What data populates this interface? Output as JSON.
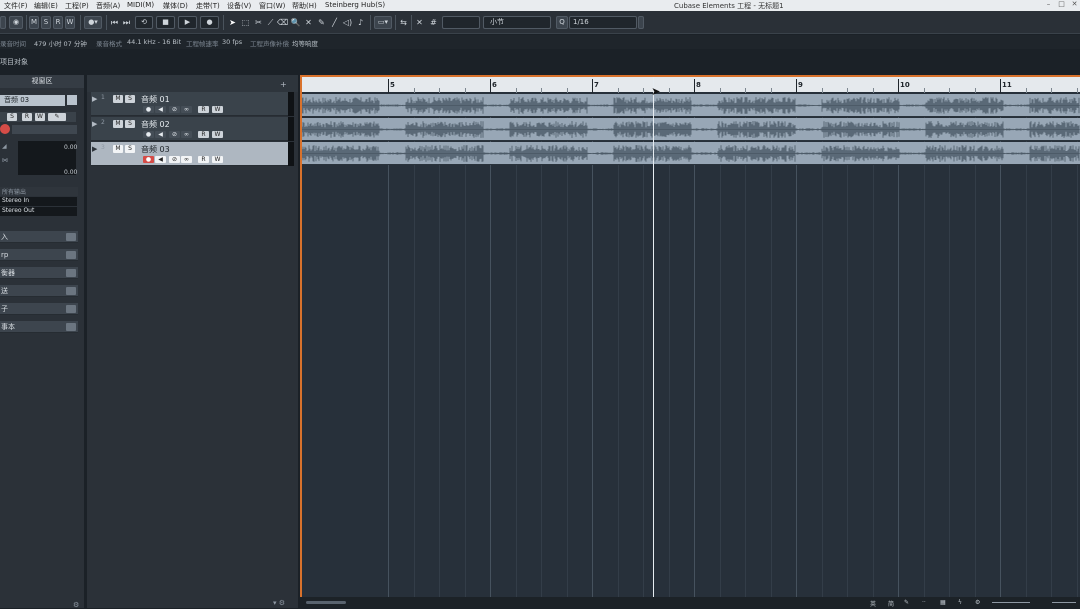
{
  "window": {
    "title": "Cubase Elements 工程 - 无标题1"
  },
  "menu": [
    {
      "label": "文件(F)"
    },
    {
      "label": "编辑(E)"
    },
    {
      "label": "工程(P)"
    },
    {
      "label": "音频(A)"
    },
    {
      "label": "MIDI(M)"
    },
    {
      "label": "媒体(D)"
    },
    {
      "label": "走带(T)"
    },
    {
      "label": "设备(V)"
    },
    {
      "label": "窗口(W)"
    },
    {
      "label": "帮助(H)"
    },
    {
      "label": "Steinberg Hub(S)"
    }
  ],
  "toolbar": {
    "m_label": "M",
    "s_label": "S",
    "r_label": "R",
    "w_label": "W",
    "snap_type": "小节",
    "quantize": "1/16"
  },
  "info_line": {
    "record_time_label": "录音时间",
    "record_time_value": "479 小时 07 分钟",
    "record_format_label": "录音格式",
    "record_format_value": "44.1 kHz - 16 Bit",
    "frame_rate_label": "工程帧速率",
    "frame_rate_value": "30 fps",
    "pan_law_label": "工程声像补偿",
    "pan_law_value": "均等响度"
  },
  "project_label": "项目对象",
  "inspector": {
    "title": "视窗区",
    "track_name": "音频 03",
    "volume_value": "0.00",
    "pan_value": "0.00",
    "routing_label": "所有输出",
    "input": "Stereo In",
    "output": "Stereo Out",
    "sections": [
      {
        "label": "入"
      },
      {
        "label": "rp"
      },
      {
        "label": "衡器"
      },
      {
        "label": "送"
      },
      {
        "label": "子"
      },
      {
        "label": "事本"
      }
    ]
  },
  "tracks": [
    {
      "number": "1",
      "name": "音频 01",
      "m": "M",
      "s": "S",
      "r": "R",
      "w": "W",
      "selected": false
    },
    {
      "number": "2",
      "name": "音频 02",
      "m": "M",
      "s": "S",
      "r": "R",
      "w": "W",
      "selected": false
    },
    {
      "number": "3",
      "name": "音频 03",
      "m": "M",
      "s": "S",
      "r": "R",
      "w": "W",
      "selected": true
    }
  ],
  "ruler": {
    "bars": [
      "5",
      "6",
      "7",
      "8",
      "9",
      "10",
      "11"
    ]
  },
  "playhead_bar": 7.6,
  "statusbar": {
    "lang": "英",
    "mode": "简"
  },
  "colors": {
    "accent": "#d9722c",
    "lane": "#98a7b6",
    "waveform": "#4c5a68",
    "background": "#27303a"
  }
}
